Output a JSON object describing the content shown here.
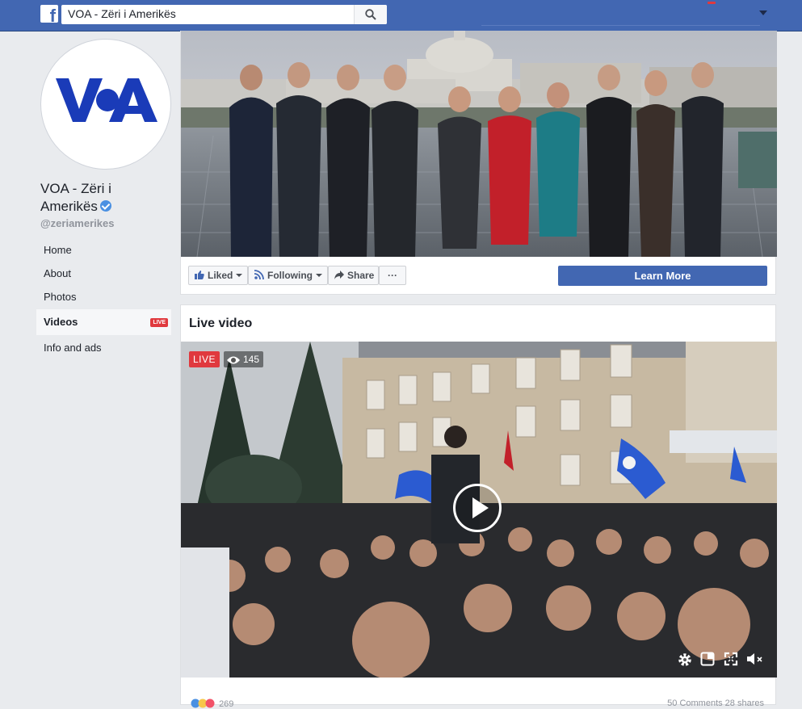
{
  "topbar": {
    "search_value": "VOA - Zëri i Amerikës",
    "logo": "f"
  },
  "page": {
    "name": "VOA - Zëri i Amerikës",
    "handle": "@zeriamerikes",
    "logo_text": "VOA"
  },
  "nav": {
    "items": [
      {
        "label": "Home"
      },
      {
        "label": "About"
      },
      {
        "label": "Photos"
      },
      {
        "label": "Videos",
        "badge": "LIVE"
      },
      {
        "label": "Info and ads"
      }
    ]
  },
  "actions": {
    "liked": "Liked",
    "following": "Following",
    "share": "Share",
    "more": "···",
    "cta": "Learn More"
  },
  "live_video": {
    "heading": "Live video",
    "badge": "LIVE",
    "viewers": "145",
    "reactions": "269",
    "comments_shares": "50 Comments  28 shares"
  },
  "colors": {
    "brand": "#4267b2",
    "live": "#e0393e",
    "voa": "#1a3bb8"
  }
}
